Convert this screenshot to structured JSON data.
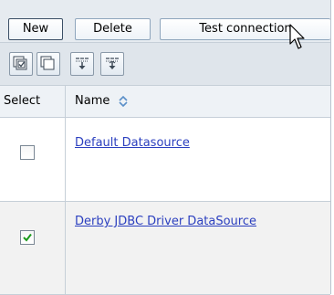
{
  "buttons": {
    "new_label": "New",
    "delete_label": "Delete",
    "test_connection_label": "Test connection"
  },
  "toolbar": {
    "icons": [
      "select-all-icon",
      "deselect-all-icon",
      "show-filter-icon",
      "hide-filter-icon"
    ]
  },
  "table": {
    "columns": [
      "Select",
      "Name"
    ],
    "sort_icon": "sort-toggle-icon",
    "rows": [
      {
        "name": "Default Datasource",
        "selected": false
      },
      {
        "name": "Derby JDBC Driver DataSource",
        "selected": true
      }
    ]
  },
  "colors": {
    "link": "#2b3fbf",
    "check": "#1a9a1a",
    "bar_bg": "#e6ebf0"
  }
}
